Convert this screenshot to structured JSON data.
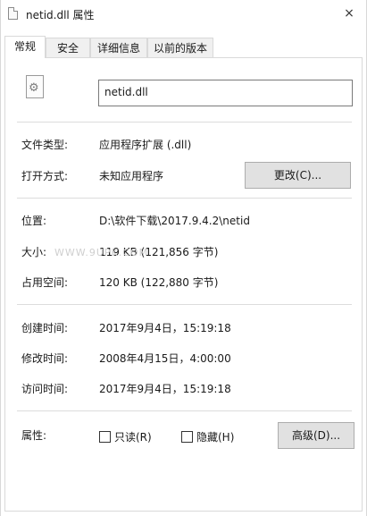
{
  "window": {
    "title": "netid.dll 属性",
    "close_glyph": "×"
  },
  "tabs": [
    {
      "label": "常规"
    },
    {
      "label": "安全"
    },
    {
      "label": "详细信息"
    },
    {
      "label": "以前的版本"
    }
  ],
  "file": {
    "name": "netid.dll"
  },
  "rows": {
    "file_type_label": "文件类型:",
    "file_type_value": "应用程序扩展 (.dll)",
    "open_with_label": "打开方式:",
    "open_with_value": "未知应用程序",
    "change_button": "更改(C)...",
    "location_label": "位置:",
    "location_value": "D:\\软件下载\\2017.9.4.2\\netid",
    "size_label": "大小:",
    "size_value": "119 KB (121,856 字节)",
    "size_on_disk_label": "占用空间:",
    "size_on_disk_value": "120 KB (122,880 字节)",
    "created_label": "创建时间:",
    "created_value": "2017年9月4日，15:19:18",
    "modified_label": "修改时间:",
    "modified_value": "2008年4月15日，4:00:00",
    "accessed_label": "访问时间:",
    "accessed_value": "2017年9月4日，15:19:18",
    "attributes_label": "属性:",
    "readonly_label": "只读(R)",
    "hidden_label": "隐藏(H)",
    "advanced_button": "高级(D)..."
  },
  "watermark": "WWW.9UPK.COM"
}
